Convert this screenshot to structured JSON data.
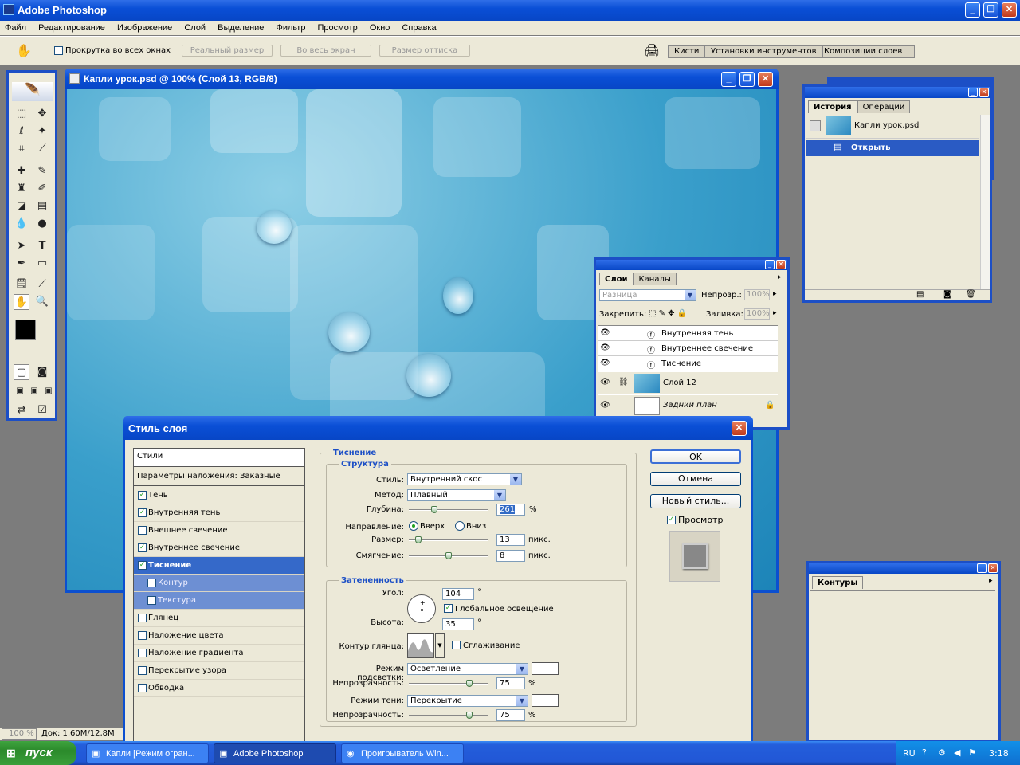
{
  "app": {
    "title": "Adobe Photoshop"
  },
  "menu": [
    "Файл",
    "Редактирование",
    "Изображение",
    "Слой",
    "Выделение",
    "Фильтр",
    "Просмотр",
    "Окно",
    "Справка"
  ],
  "options": {
    "scroll_all": "Прокрутка во всех окнах",
    "actual": "Реальный размер",
    "fit": "Во весь экран",
    "print": "Размер оттиска"
  },
  "palette_well": [
    "Кисти",
    "Установки инструментов",
    "Композиции слоев"
  ],
  "doc": {
    "title": "Капли урок.psd @ 100% (Слой 13, RGB/8)"
  },
  "history": {
    "tabs": [
      "История",
      "Операции"
    ],
    "snapshot": "Капли урок.psd",
    "step": "Открыть"
  },
  "layers": {
    "tabs": [
      "Слои",
      "Каналы"
    ],
    "blend": "Разница",
    "opacity_label": "Непрозр.:",
    "opacity": "100%",
    "lock_label": "Закрепить:",
    "fill_label": "Заливка:",
    "fill": "100%",
    "effects": [
      "Внутренняя тень",
      "Внутреннее свечение",
      "Тиснение"
    ],
    "layer12": "Слой 12",
    "background": "Задний план"
  },
  "paths": {
    "tab": "Контуры"
  },
  "status": {
    "zoom": "100 %",
    "doc": "Док: 1,60M/12,8M"
  },
  "dialog": {
    "title": "Стиль слоя",
    "styles_header": "Стили",
    "blend_options": "Параметры наложения: Заказные",
    "styles": [
      {
        "label": "Тень",
        "checked": true
      },
      {
        "label": "Внутренняя тень",
        "checked": true
      },
      {
        "label": "Внешнее свечение",
        "checked": false
      },
      {
        "label": "Внутреннее свечение",
        "checked": true
      },
      {
        "label": "Тиснение",
        "checked": true
      },
      {
        "label": "Контур",
        "checked": false
      },
      {
        "label": "Текстура",
        "checked": false
      },
      {
        "label": "Глянец",
        "checked": false
      },
      {
        "label": "Наложение цвета",
        "checked": false
      },
      {
        "label": "Наложение градиента",
        "checked": false
      },
      {
        "label": "Перекрытие узора",
        "checked": false
      },
      {
        "label": "Обводка",
        "checked": false
      }
    ],
    "section": "Тиснение",
    "structure": "Структура",
    "style_label": "Стиль:",
    "style_value": "Внутренний скос",
    "method_label": "Метод:",
    "method_value": "Плавный",
    "depth_label": "Глубина:",
    "depth_value": "261",
    "percent": "%",
    "direction_label": "Направление:",
    "up": "Вверх",
    "down": "Вниз",
    "size_label": "Размер:",
    "size_value": "13",
    "px": "пикс.",
    "soften_label": "Смягчение:",
    "soften_value": "8",
    "shading": "Затененность",
    "angle_label": "Угол:",
    "angle_value": "104",
    "degree": "°",
    "global_light": "Глобальное освещение",
    "altitude_label": "Высота:",
    "altitude_value": "35",
    "gloss_label": "Контур глянца:",
    "antialias": "Сглаживание",
    "highlight_label": "Режим подсветки:",
    "highlight_value": "Осветление",
    "hl_opacity_label": "Непрозрачность:",
    "hl_opacity_value": "75",
    "shadow_label": "Режим тени:",
    "shadow_value": "Перекрытие",
    "sh_opacity_label": "Непрозрачность:",
    "sh_opacity_value": "75",
    "ok": "OK",
    "cancel": "Отмена",
    "new_style": "Новый стиль...",
    "preview": "Просмотр"
  },
  "taskbar": {
    "start": "пуск",
    "tasks": [
      "Капли [Режим огран...",
      "Adobe Photoshop",
      "Проигрыватель Win..."
    ],
    "lang": "RU",
    "time": "3:18"
  }
}
